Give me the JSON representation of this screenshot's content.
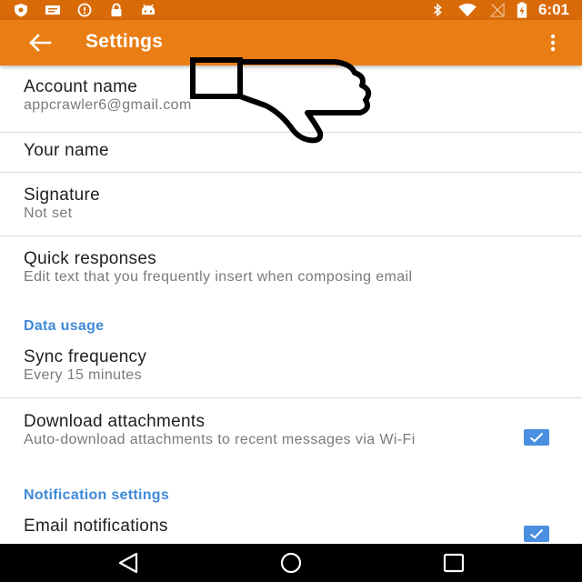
{
  "status_bar": {
    "time": "6:01",
    "left_icons": [
      "shield-icon",
      "message-icon",
      "alert-circle-icon",
      "lock-icon",
      "android-icon"
    ],
    "right_icons": [
      "bluetooth-icon",
      "wifi-icon",
      "signal-icon",
      "battery-icon"
    ]
  },
  "toolbar": {
    "title": "Settings",
    "back_icon": "arrow-left-icon",
    "overflow_icon": "more-vert-icon",
    "color": "#e97e15"
  },
  "settings": {
    "account_name": {
      "label": "Account name",
      "value": "appcrawler6@gmail.com"
    },
    "your_name": {
      "label": "Your name"
    },
    "signature": {
      "label": "Signature",
      "value": "Not set"
    },
    "quick_responses": {
      "label": "Quick responses",
      "value": "Edit text that you frequently insert when composing email"
    },
    "data_usage_header": "Data usage",
    "sync_frequency": {
      "label": "Sync frequency",
      "value": "Every 15 minutes"
    },
    "download_attachments": {
      "label": "Download attachments",
      "value": "Auto-download attachments to recent messages via Wi-Fi",
      "checked": true
    },
    "notification_header": "Notification settings",
    "email_notifications": {
      "label": "Email notifications",
      "checked": true
    }
  },
  "accent_color": "#3f8ad8",
  "overlay_icon": "thumbs-down-icon",
  "nav_bar": [
    "back-triangle-icon",
    "home-circle-icon",
    "recents-square-icon"
  ]
}
